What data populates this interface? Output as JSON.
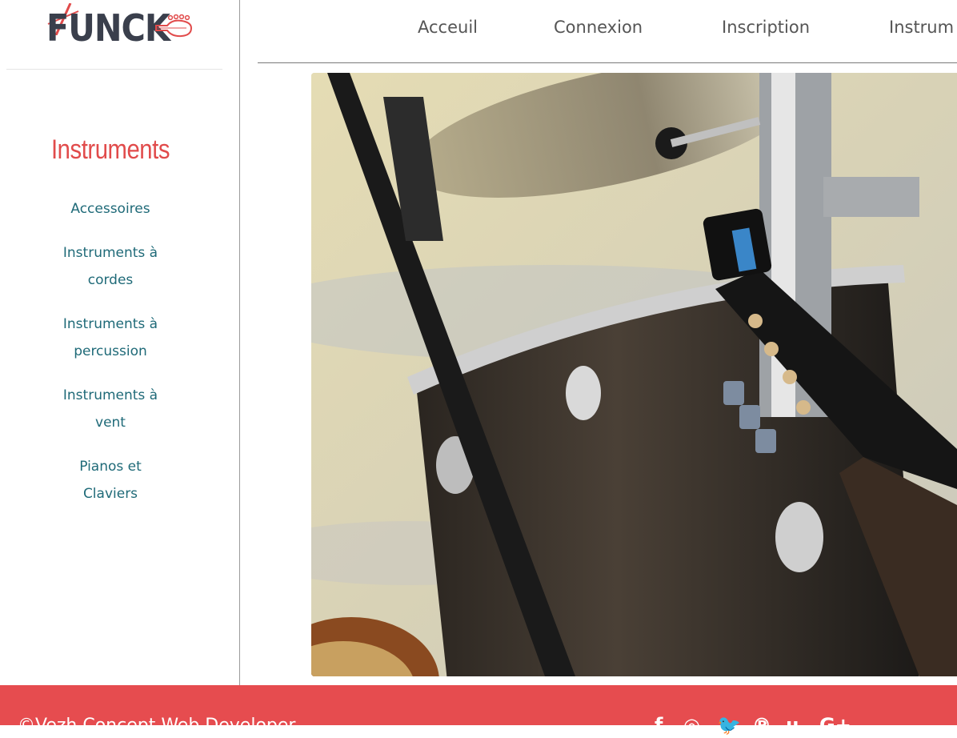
{
  "logo": {
    "text": "FUNCK"
  },
  "sidebar": {
    "title": "Instruments",
    "items": [
      {
        "line1": "Accessoires",
        "line2": ""
      },
      {
        "line1": "Instruments à",
        "line2": "cordes"
      },
      {
        "line1": "Instruments à",
        "line2": "percussion"
      },
      {
        "line1": "Instruments à",
        "line2": "vent"
      },
      {
        "line1": "Pianos et",
        "line2": "Claviers"
      }
    ]
  },
  "nav": {
    "items": [
      "Acceuil",
      "Connexion",
      "Inscription",
      "Instrum"
    ]
  },
  "footer": {
    "copy": "©Vezh Concept Web Developer",
    "social": [
      "facebook-icon",
      "instagram-icon",
      "twitter-icon",
      "pinterest-icon",
      "unknown-icon",
      "google-plus-icon"
    ]
  },
  "colors": {
    "brand_red": "#e14b4b",
    "footer_bg": "#e64c4f",
    "link_teal": "#1f6a78",
    "logo_dark": "#3a3f4c"
  }
}
